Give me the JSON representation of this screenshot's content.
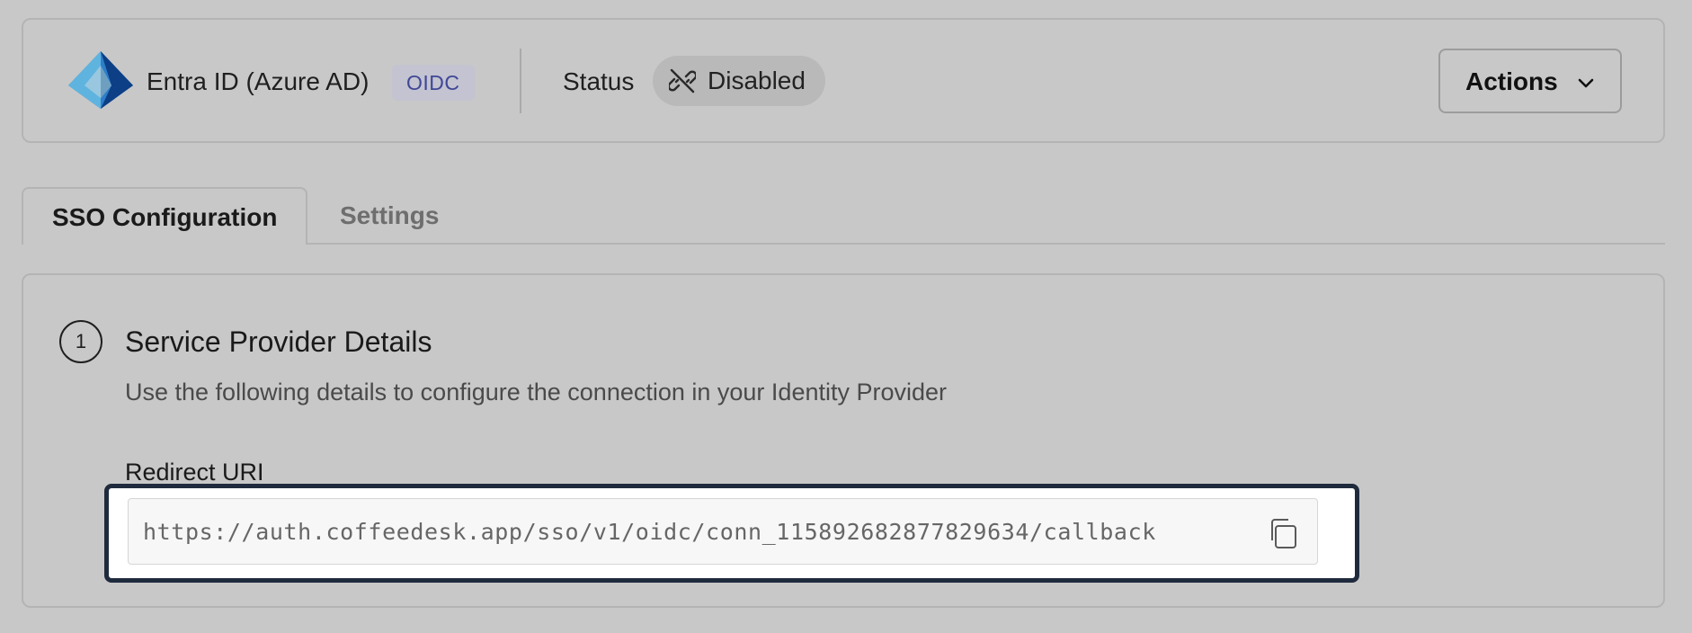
{
  "provider": {
    "name": "Entra ID (Azure AD)",
    "protocol_badge": "OIDC",
    "logo_icon": "azure-ad-logo"
  },
  "status": {
    "label": "Status",
    "value": "Disabled",
    "icon": "unlink-icon"
  },
  "actions": {
    "label": "Actions",
    "icon": "chevron-down-icon"
  },
  "tabs": [
    {
      "label": "SSO Configuration",
      "active": true
    },
    {
      "label": "Settings",
      "active": false
    }
  ],
  "section": {
    "step_number": "1",
    "title": "Service Provider Details",
    "description": "Use the following details to configure the connection in your Identity Provider"
  },
  "redirect": {
    "label": "Redirect URI",
    "value": "https://auth.coffeedesk.app/sso/v1/oidc/conn_115892682877829634/callback",
    "copy_icon": "copy-icon"
  },
  "colors": {
    "background": "#c8c8c8",
    "badge_bg": "#c3c3d1",
    "badge_text": "#3f4796",
    "focus_ring": "#1f2b3d"
  }
}
